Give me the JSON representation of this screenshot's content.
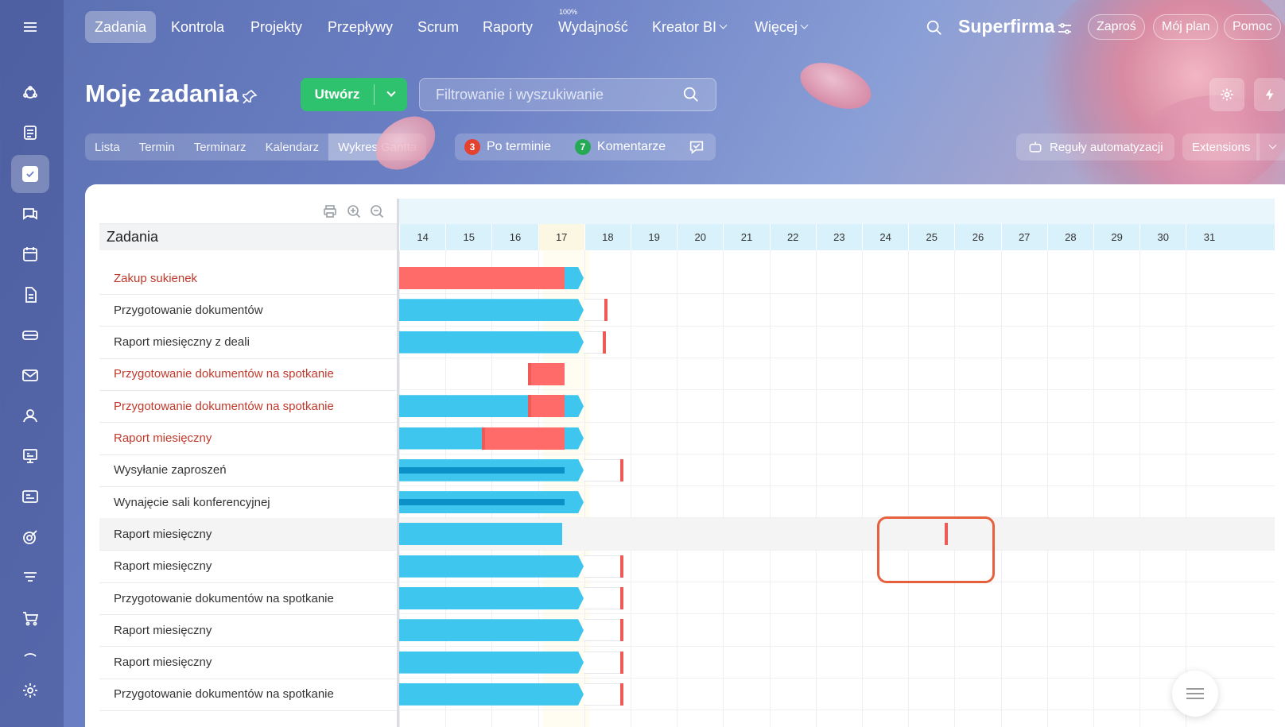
{
  "topnav": {
    "items": [
      "Zadania",
      "Kontrola",
      "Projekty",
      "Przepływy",
      "Scrum",
      "Raporty",
      "Wydajność",
      "Kreator BI",
      "Więcej"
    ],
    "efficiency_badge": "100%",
    "brand": "Superfirma",
    "invite": "Zaproś",
    "my_plan": "Mój plan",
    "help": "Pomoc"
  },
  "header": {
    "title": "Moje zadania",
    "create": "Utwórz",
    "search_placeholder": "Filtrowanie i wyszukiwanie"
  },
  "views": {
    "tabs": [
      "Lista",
      "Termin",
      "Terminarz",
      "Kalendarz",
      "Wykres Gantta"
    ],
    "active": "Wykres Gantta"
  },
  "counters": {
    "overdue_count": "3",
    "overdue_label": "Po terminie",
    "comments_count": "7",
    "comments_label": "Komentarze"
  },
  "automation": {
    "rules": "Reguły automatyzacji",
    "extensions": "Extensions"
  },
  "tasks": {
    "header": "Zadania",
    "rows": [
      {
        "name": "Zakup sukienek",
        "overdue": true
      },
      {
        "name": "Przygotowanie dokumentów",
        "overdue": false
      },
      {
        "name": "Raport miesięczny z deali",
        "overdue": false
      },
      {
        "name": "Przygotowanie dokumentów na spotkanie",
        "overdue": true
      },
      {
        "name": "Przygotowanie dokumentów na spotkanie",
        "overdue": true
      },
      {
        "name": "Raport miesięczny",
        "overdue": true
      },
      {
        "name": "Wysyłanie zaproszeń",
        "overdue": false
      },
      {
        "name": "Wynajęcie sali konferencyjnej",
        "overdue": false
      },
      {
        "name": "Raport miesięczny",
        "overdue": false,
        "selected": true
      },
      {
        "name": "Raport miesięczny",
        "overdue": false
      },
      {
        "name": "Przygotowanie dokumentów na spotkanie",
        "overdue": false
      },
      {
        "name": "Raport miesięczny",
        "overdue": false
      },
      {
        "name": "Raport miesięczny",
        "overdue": false
      },
      {
        "name": "Przygotowanie dokumentów na spotkanie",
        "overdue": false
      }
    ]
  },
  "gantt": {
    "days": [
      "14",
      "15",
      "16",
      "17",
      "18",
      "19",
      "20",
      "21",
      "22",
      "23",
      "24",
      "25",
      "26",
      "27",
      "28",
      "29",
      "30",
      "31"
    ],
    "today": "17"
  },
  "colors": {
    "accent_green": "#2fc26e",
    "bar_blue": "#3fc6ef",
    "bar_red": "#ff6b68",
    "overdue_text": "#c0392b"
  },
  "icons": [
    "menu-icon",
    "pin-icon",
    "search-icon",
    "settings-icon",
    "flash-icon",
    "chat-icon",
    "robot-icon",
    "print-icon",
    "zoom-in-icon",
    "zoom-out-icon"
  ]
}
